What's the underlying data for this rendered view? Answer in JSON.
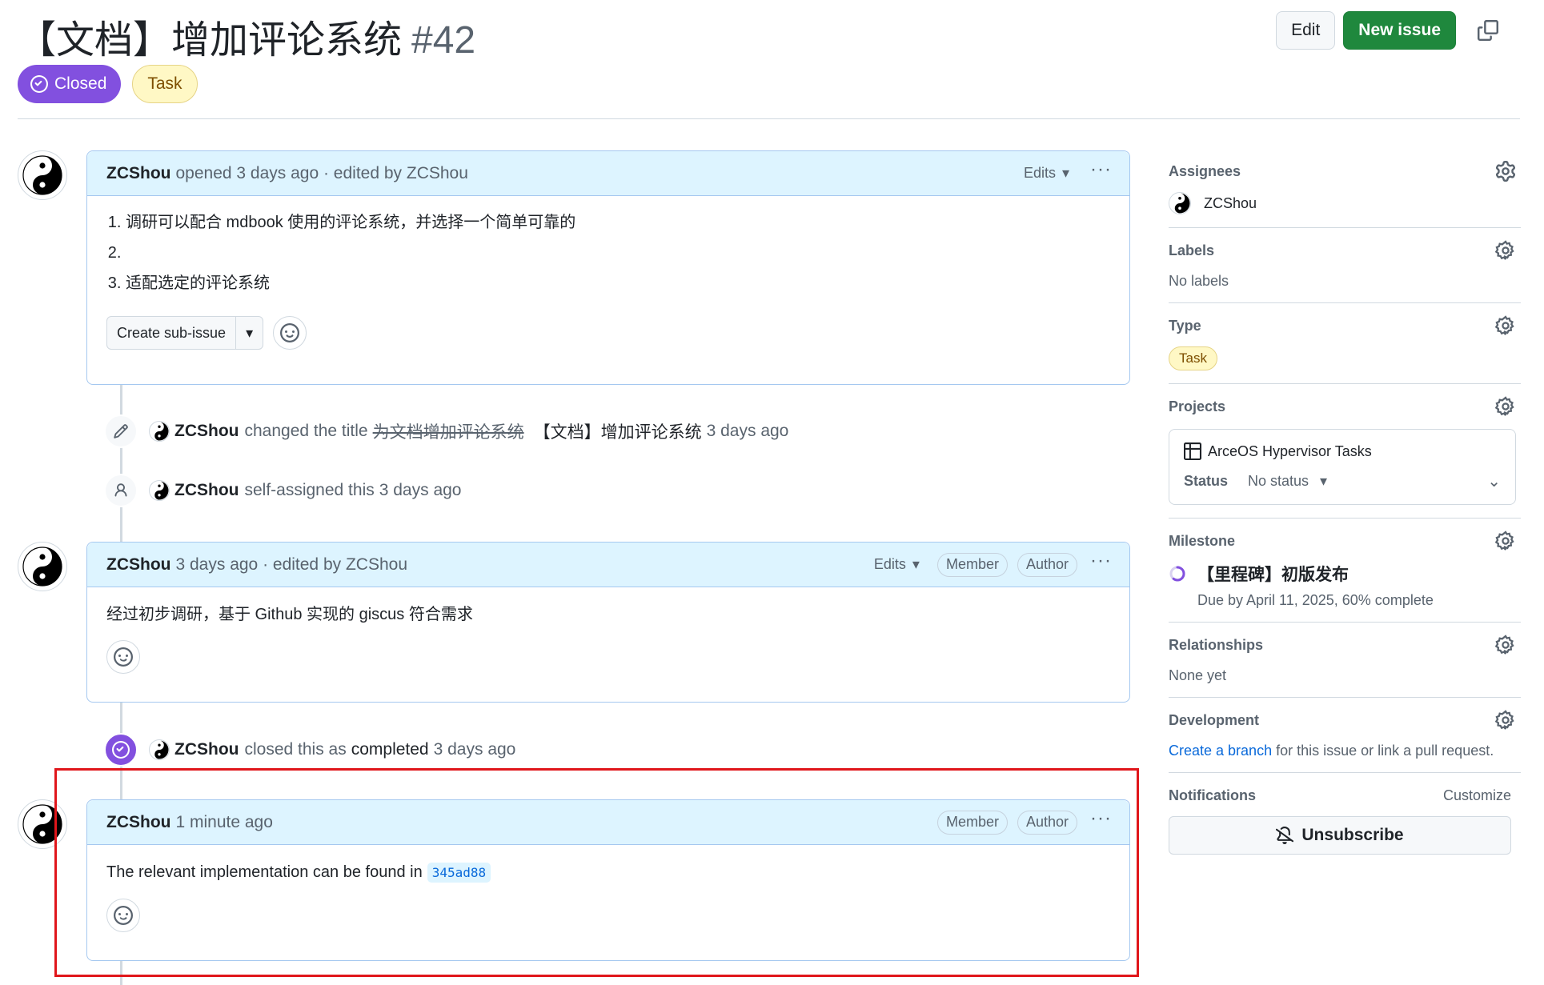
{
  "issue": {
    "title": "【文档】增加评论系统",
    "number": "#42",
    "state": "Closed",
    "type": "Task"
  },
  "header": {
    "edit_label": "Edit",
    "new_issue_label": "New issue"
  },
  "comments": [
    {
      "author": "ZCShou",
      "meta": "opened 3 days ago · edited by ZCShou",
      "edits_label": "Edits",
      "items": [
        "调研可以配合 mdbook 使用的评论系统，并选择一个简单可靠的",
        "",
        "适配选定的评论系统"
      ],
      "sub_issue_label": "Create sub-issue"
    },
    {
      "author": "ZCShou",
      "meta": "3 days ago · edited by ZCShou",
      "edits_label": "Edits",
      "member": "Member",
      "author_badge": "Author",
      "body": "经过初步调研，基于 Github 实现的 giscus 符合需求"
    },
    {
      "author": "ZCShou",
      "meta": "1 minute ago",
      "member": "Member",
      "author_badge": "Author",
      "body": "The relevant implementation can be found in",
      "commit": "345ad88"
    }
  ],
  "events": [
    {
      "author": "ZCShou",
      "text": "changed the title",
      "old_title": "为文档增加评论系统",
      "new_title": "【文档】增加评论系统",
      "time": "3 days ago"
    },
    {
      "author": "ZCShou",
      "text": "self-assigned this",
      "time": "3 days ago"
    },
    {
      "author": "ZCShou",
      "text": "closed this as",
      "strong": "completed",
      "time": "3 days ago"
    }
  ],
  "sidebar": {
    "assignees": {
      "title": "Assignees",
      "user": "ZCShou"
    },
    "labels": {
      "title": "Labels",
      "value": "No labels"
    },
    "type": {
      "title": "Type",
      "value": "Task"
    },
    "projects": {
      "title": "Projects",
      "name": "ArceOS Hypervisor Tasks",
      "status_key": "Status",
      "status_value": "No status"
    },
    "milestone": {
      "title": "Milestone",
      "name": "【里程碑】初版发布",
      "due": "Due by April 11, 2025, 60% complete",
      "progress": 0.6
    },
    "relationships": {
      "title": "Relationships",
      "value": "None yet"
    },
    "development": {
      "title": "Development",
      "link": "Create a branch",
      "rest": "for this issue or link a pull request."
    },
    "notifications": {
      "title": "Notifications",
      "customize": "Customize",
      "button": "Unsubscribe"
    }
  },
  "colors": {
    "accent_green": "#1f883d",
    "closed_purple": "#8250df",
    "highlight_red": "#e0161b"
  }
}
